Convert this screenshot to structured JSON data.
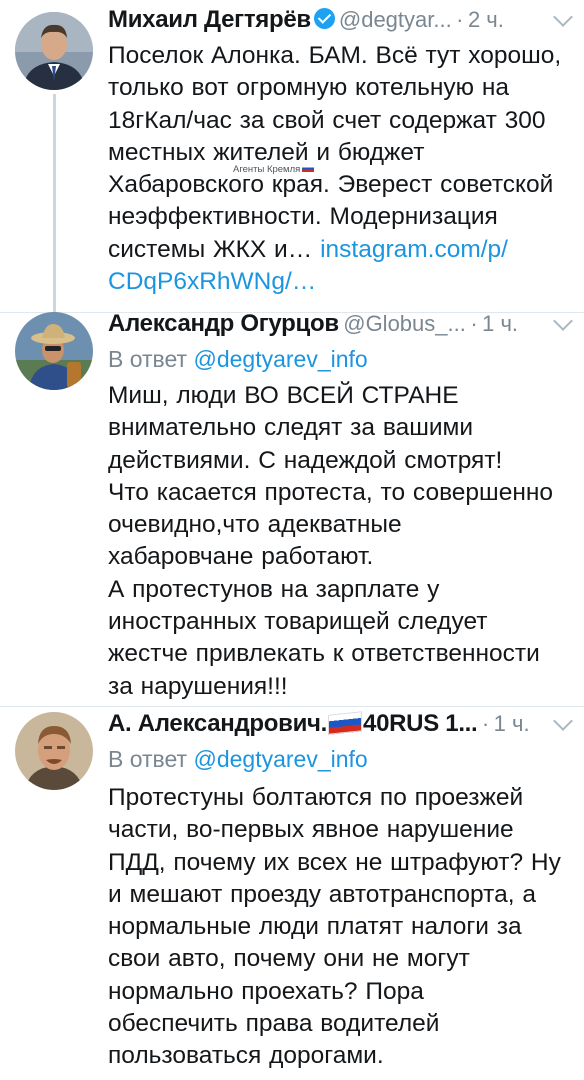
{
  "tweets": [
    {
      "author_name": "Михаил Дегтярёв",
      "handle": "@degtyar...",
      "dot": "·",
      "time": "2 ч.",
      "verified": true,
      "body_lines": [
        "Поселок Алонка. БАМ. Всё тут хорошо,",
        "только вот огромную котельную на",
        "18гКал/час за свой счет содержат 300",
        "местных жителей и бюджет",
        "Хабаровского края. Эверест советской",
        "неэффективности. Модернизация",
        "системы ЖКХ и…"
      ],
      "link_part1": "instagram.com/p/",
      "link_part2": "CDqP6xRhWNg/…"
    },
    {
      "author_name": "Александр Огурцов",
      "handle": "@Globus_...",
      "dot": "·",
      "time": "1 ч.",
      "reply_prefix": "В ответ",
      "reply_mention": "@degtyarev_info",
      "body_lines": [
        "Миш, люди ВО ВСЕЙ СТРАНЕ",
        "внимательно следят за вашими",
        "действиями. С надеждой смотрят!",
        "Что касается протеста, то совершенно",
        "очевидно,что адекватные",
        "хабаровчане работают.",
        "А протестунов на зарплате у",
        "иностранных товарищей следует",
        "жестче привлекать к ответственности",
        "за нарушения!!!"
      ]
    },
    {
      "author_name_part1": "А. Александрович.",
      "author_name_part2": "40RUS 1...",
      "dot": "·",
      "time": "1 ч.",
      "reply_prefix": "В ответ",
      "reply_mention": "@degtyarev_info",
      "body_lines": [
        "Протестуны болтаются по проезжей",
        "части, во-первых явное нарушение",
        "ПДД, почему их всех не штрафуют? Ну",
        "и мешают проезду автотранспорта, а",
        "нормальные люди платят налоги за",
        "свои авто, почему они не могут",
        "нормально проехать? Пора",
        "обеспечить права водителей",
        "пользоваться дорогами."
      ]
    }
  ],
  "watermark_text": "Агенты Кремля",
  "icons": {
    "verified": "verified-badge-icon",
    "more": "chevron-down-icon",
    "flag": "russian-flag-icon"
  },
  "colors": {
    "link": "#1b95e0",
    "muted": "#7a8791",
    "verified": "#1da1f2"
  }
}
